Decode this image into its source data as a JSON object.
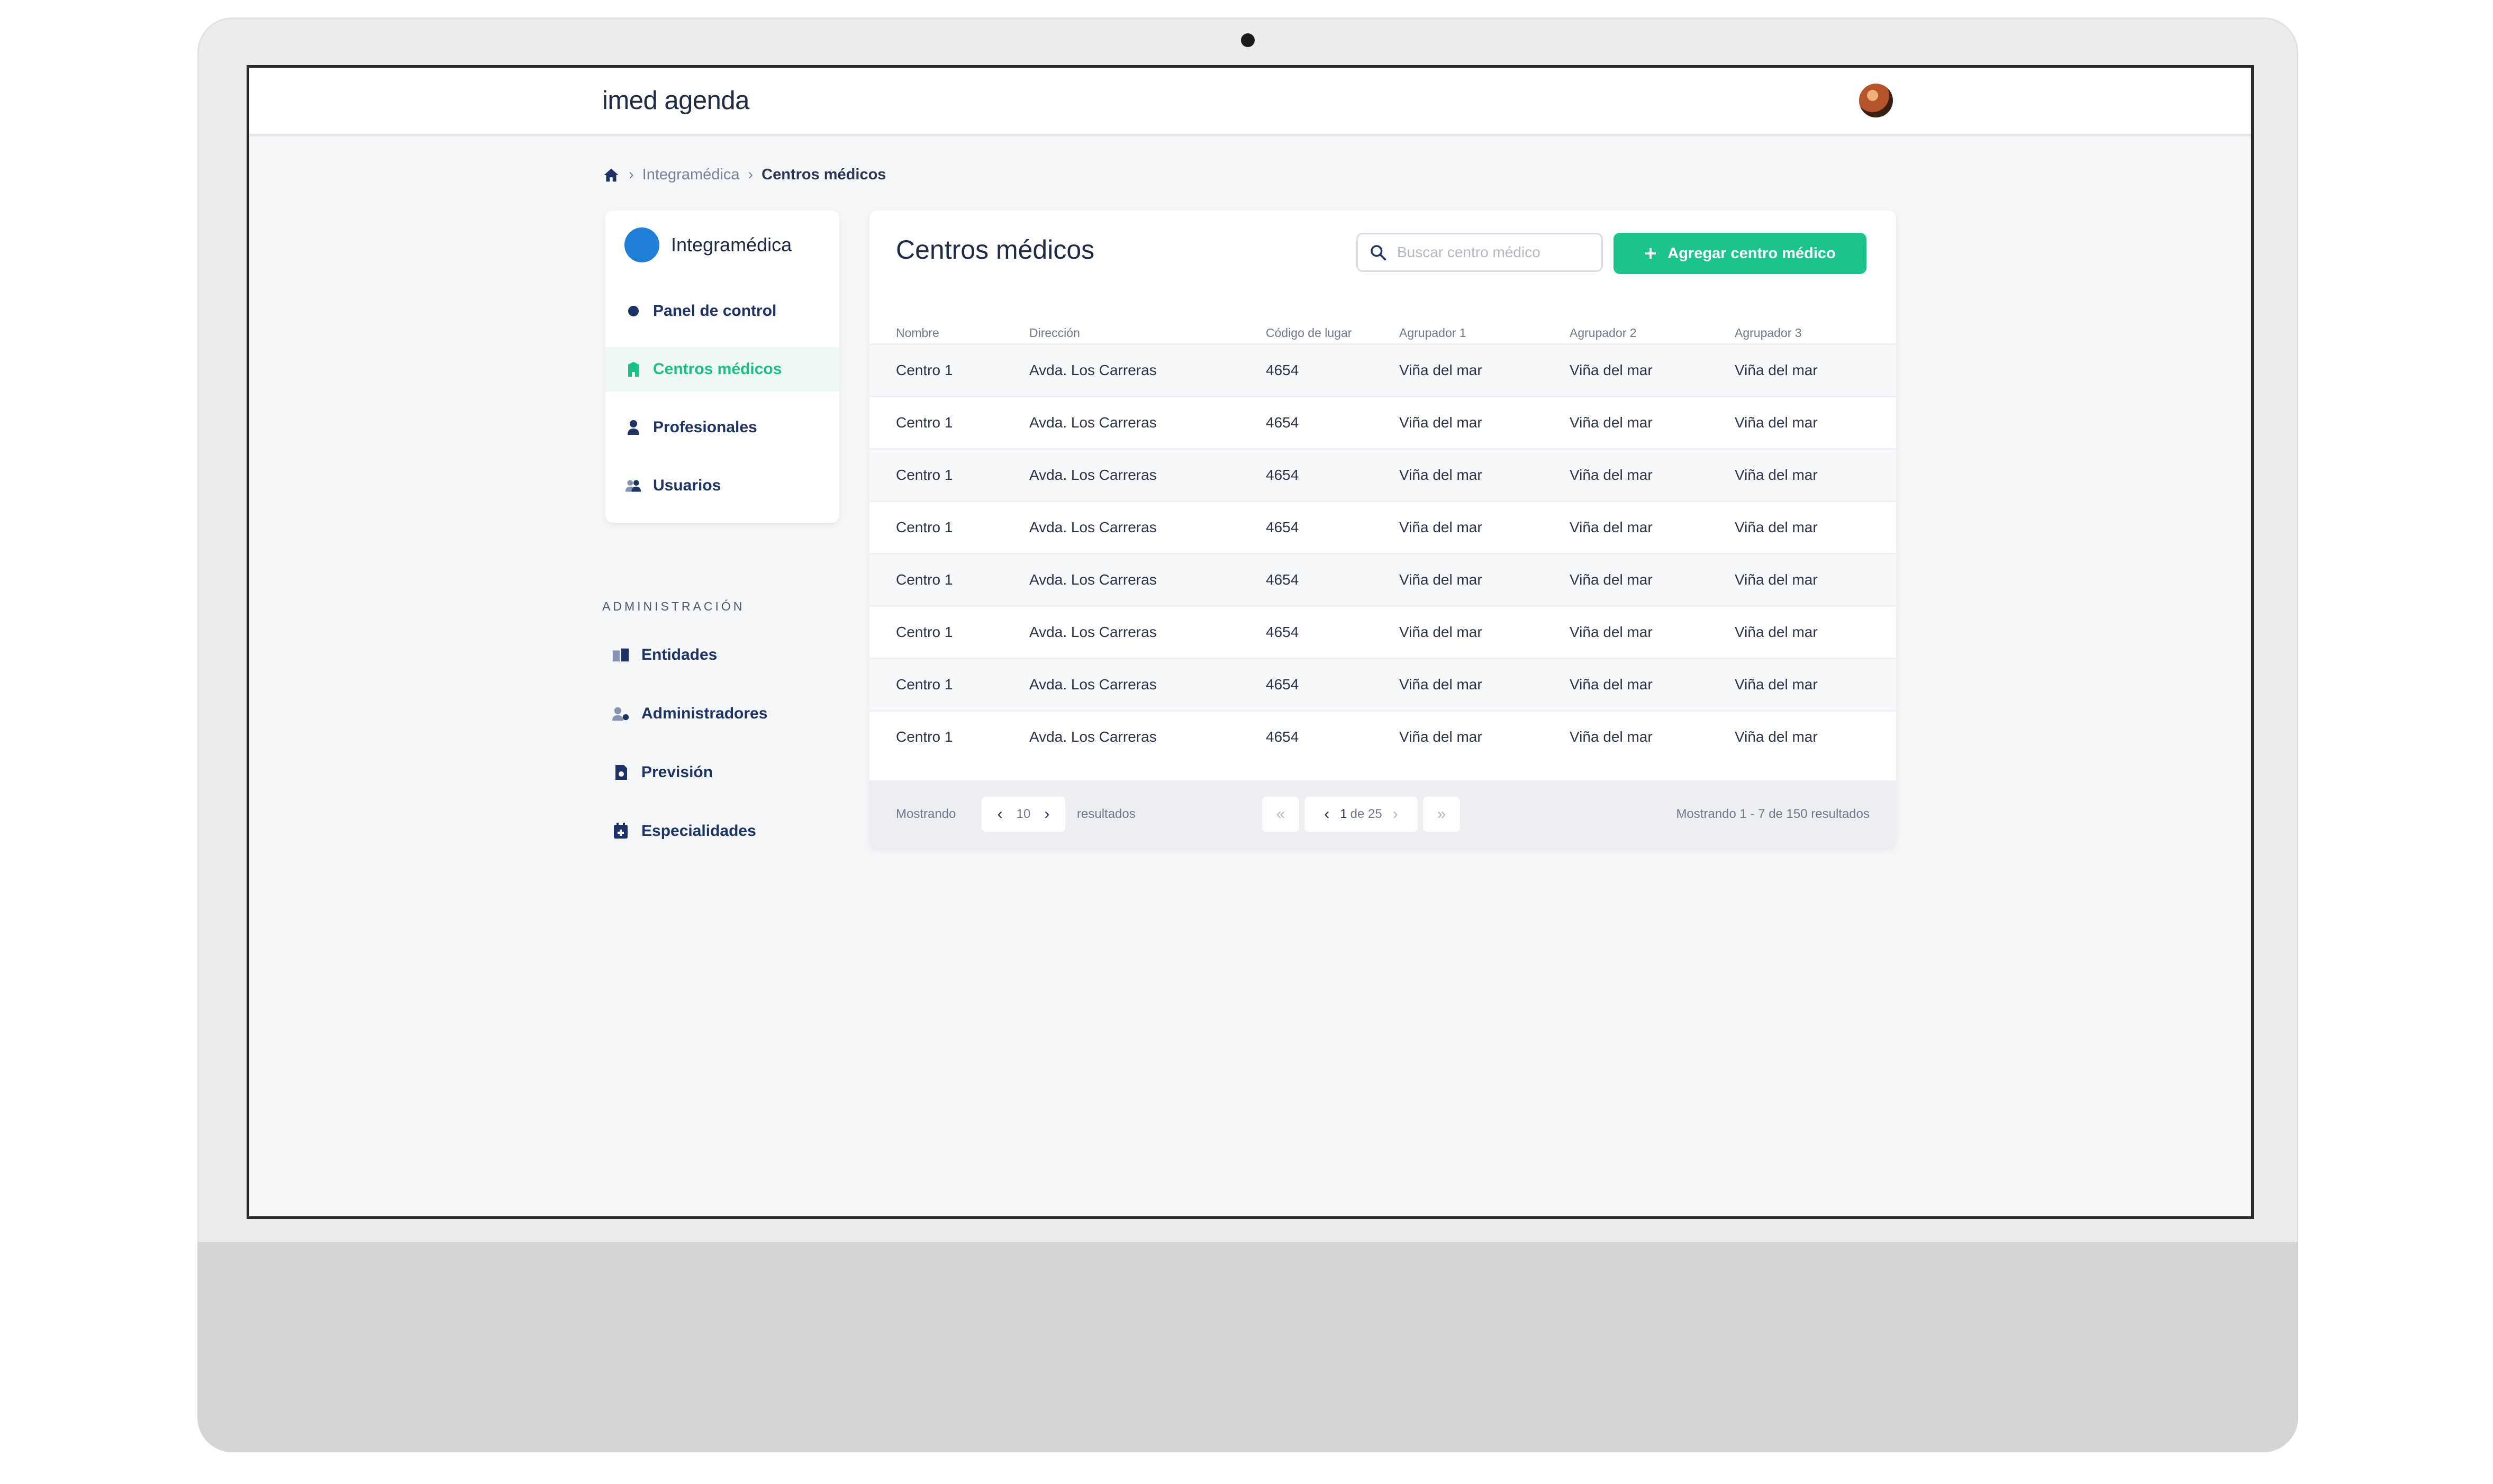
{
  "app": {
    "brand": "imed agenda"
  },
  "breadcrumb": {
    "items": [
      "Integramédica",
      "Centros médicos"
    ]
  },
  "sidebar": {
    "org_name": "Integramédica",
    "items": [
      {
        "label": "Panel de control",
        "icon": "dashboard-icon"
      },
      {
        "label": "Centros médicos",
        "icon": "building-icon",
        "active": true
      },
      {
        "label": "Profesionales",
        "icon": "professional-icon"
      },
      {
        "label": "Usuarios",
        "icon": "users-icon"
      }
    ],
    "admin_label": "ADMINISTRACIÓN",
    "admin_items": [
      {
        "label": "Entidades",
        "icon": "entities-icon"
      },
      {
        "label": "Administradores",
        "icon": "admins-icon"
      },
      {
        "label": "Previsión",
        "icon": "forecast-icon"
      },
      {
        "label": "Especialidades",
        "icon": "specialties-icon"
      }
    ]
  },
  "main": {
    "title": "Centros médicos",
    "search_placeholder": "Buscar centro médico",
    "add_button": "Agregar centro médico",
    "columns": [
      "Nombre",
      "Dirección",
      "Código de lugar",
      "Agrupador 1",
      "Agrupador 2",
      "Agrupador 3"
    ],
    "rows": [
      [
        "Centro 1",
        "Avda. Los Carreras",
        "4654",
        "Viña del mar",
        "Viña del mar",
        "Viña del mar"
      ],
      [
        "Centro 1",
        "Avda. Los Carreras",
        "4654",
        "Viña del mar",
        "Viña del mar",
        "Viña del mar"
      ],
      [
        "Centro 1",
        "Avda. Los Carreras",
        "4654",
        "Viña del mar",
        "Viña del mar",
        "Viña del mar"
      ],
      [
        "Centro 1",
        "Avda. Los Carreras",
        "4654",
        "Viña del mar",
        "Viña del mar",
        "Viña del mar"
      ],
      [
        "Centro 1",
        "Avda. Los Carreras",
        "4654",
        "Viña del mar",
        "Viña del mar",
        "Viña del mar"
      ],
      [
        "Centro 1",
        "Avda. Los Carreras",
        "4654",
        "Viña del mar",
        "Viña del mar",
        "Viña del mar"
      ],
      [
        "Centro 1",
        "Avda. Los Carreras",
        "4654",
        "Viña del mar",
        "Viña del mar",
        "Viña del mar"
      ],
      [
        "Centro 1",
        "Avda. Los Carreras",
        "4654",
        "Viña del mar",
        "Viña del mar",
        "Viña del mar"
      ]
    ]
  },
  "pager": {
    "showing_label": "Mostrando",
    "page_size": "10",
    "results_label": "resultados",
    "current_page": "1",
    "of_pages": "de 25",
    "summary": "Mostrando 1 - 7 de 150 resultados"
  },
  "colors": {
    "accent": "#1cc489",
    "navy": "#1f3266"
  }
}
